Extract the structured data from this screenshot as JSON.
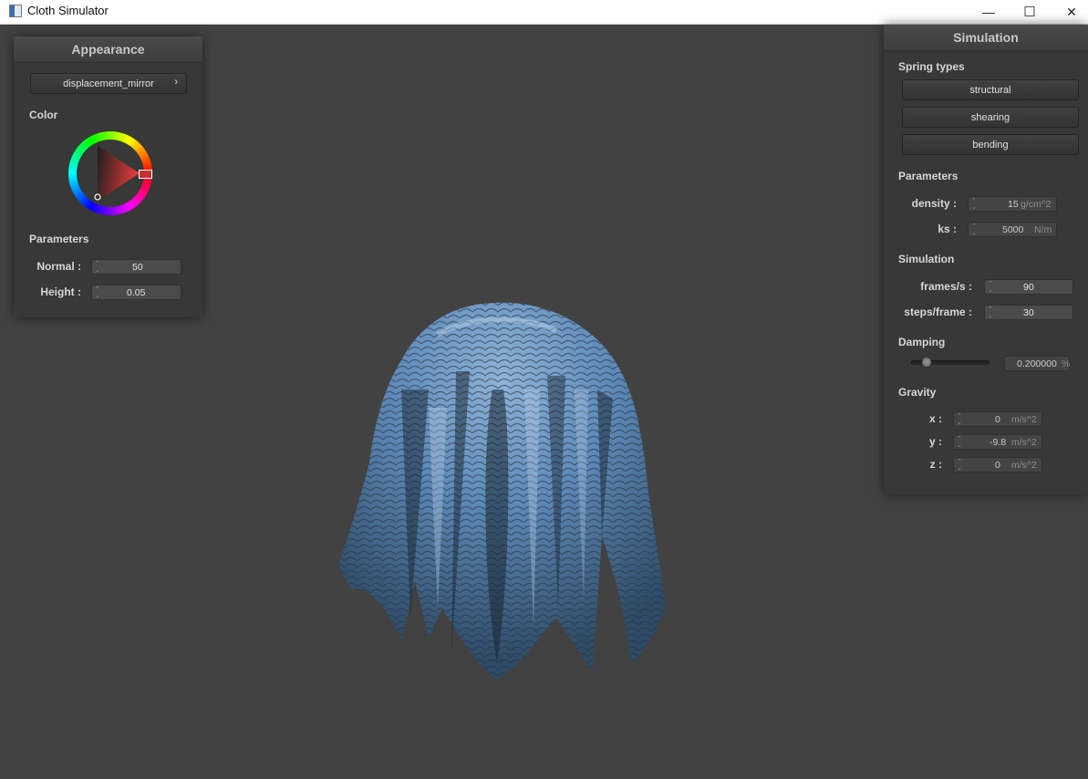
{
  "window": {
    "title": "Cloth Simulator",
    "minimize": "—",
    "maximize": "☐",
    "close": "✕"
  },
  "appearance": {
    "title": "Appearance",
    "shader_selected": "displacement_mirror",
    "shader_arrow": "›",
    "color_label": "Color",
    "params_label": "Parameters",
    "normal_label": "Normal :",
    "normal_value": "50",
    "height_label": "Height :",
    "height_value": "0.05"
  },
  "simulation": {
    "title": "Simulation",
    "spring_types_label": "Spring types",
    "springs": [
      "structural",
      "shearing",
      "bending"
    ],
    "params_label": "Parameters",
    "density_label": "density :",
    "density_value": "15",
    "density_unit": "g/cm^2",
    "ks_label": "ks :",
    "ks_value": "5000",
    "ks_unit": "N/m",
    "sim_label": "Simulation",
    "fps_label": "frames/s :",
    "fps_value": "90",
    "steps_label": "steps/frame :",
    "steps_value": "30",
    "damping_label": "Damping",
    "damping_fraction": 0.2,
    "damping_value": "0.200000",
    "damping_unit": "%",
    "gravity_label": "Gravity",
    "gx_label": "x :",
    "gx_value": "0",
    "gx_unit": "m/s^2",
    "gy_label": "y :",
    "gy_value": "-9.8",
    "gy_unit": "m/s^2",
    "gz_label": "z :",
    "gz_value": "0",
    "gz_unit": "m/s^2"
  },
  "colors": {
    "background": "#424242",
    "panel": "#383838",
    "cloth": "#5b87b4",
    "picked_color": "#c4332f"
  }
}
